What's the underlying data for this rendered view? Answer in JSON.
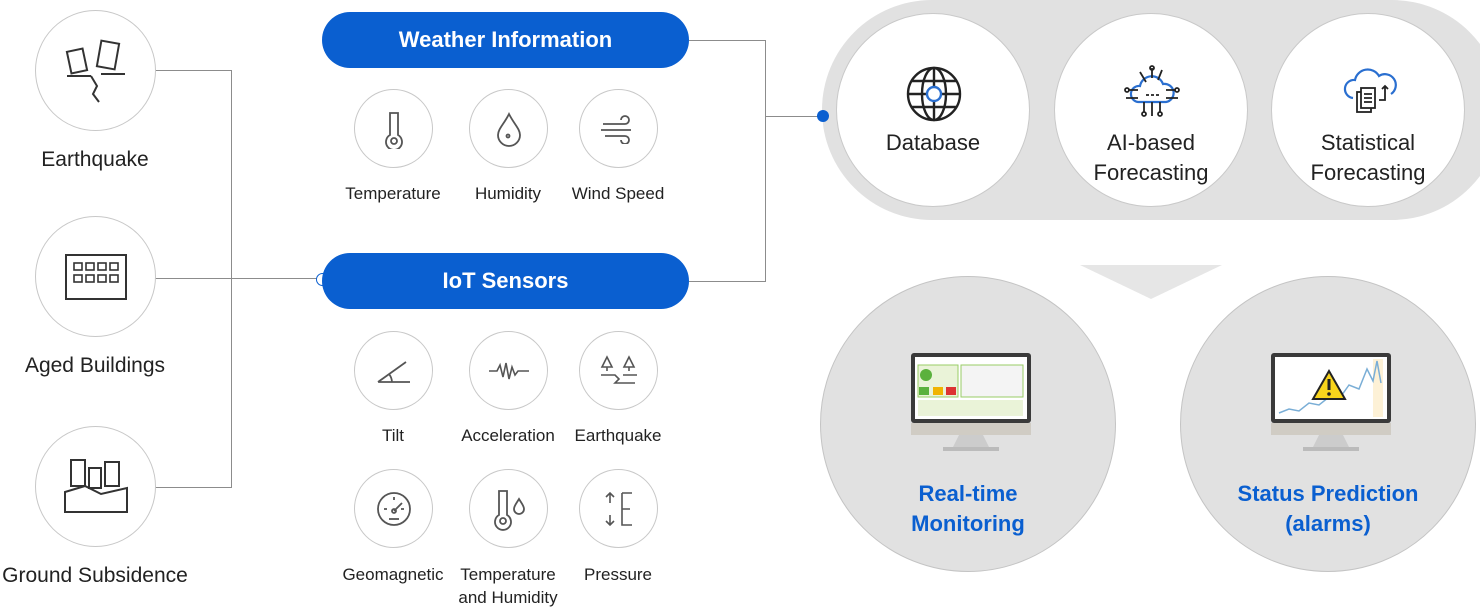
{
  "colors": {
    "accent": "#0a5fd0",
    "panel": "#e1e1e1",
    "line": "#8c8c8c"
  },
  "hazards": [
    {
      "label": "Earthquake",
      "icon": "collapsing-buildings-icon"
    },
    {
      "label": "Aged Buildings",
      "icon": "cracked-building-icon"
    },
    {
      "label": "Ground Subsidence",
      "icon": "sinking-buildings-icon"
    }
  ],
  "weather": {
    "title": "Weather Information",
    "items": [
      {
        "label": "Temperature",
        "icon": "thermometer-icon"
      },
      {
        "label": "Humidity",
        "icon": "water-drop-icon"
      },
      {
        "label": "Wind Speed",
        "icon": "wind-icon"
      }
    ]
  },
  "iot": {
    "title": "IoT Sensors",
    "items": [
      {
        "label": "Tilt",
        "icon": "angle-icon"
      },
      {
        "label": "Acceleration",
        "icon": "waveform-icon"
      },
      {
        "label": "Earthquake",
        "icon": "ground-crack-icon"
      },
      {
        "label": "Geomagnetic",
        "icon": "gauge-icon"
      },
      {
        "label": "Temperature and Humidity",
        "line1": "Temperature",
        "line2": "and Humidity",
        "icon": "thermometer-drop-icon"
      },
      {
        "label": "Pressure",
        "icon": "pressure-icon"
      }
    ]
  },
  "processing": [
    {
      "line1": "Database",
      "line2": "",
      "icon": "globe-icon"
    },
    {
      "line1": "AI-based",
      "line2": "Forecasting",
      "icon": "ai-cloud-icon"
    },
    {
      "line1": "Statistical",
      "line2": "Forecasting",
      "icon": "cloud-documents-icon"
    }
  ],
  "outputs": [
    {
      "line1": "Real-time",
      "line2": "Monitoring",
      "icon": "monitor-dashboard-icon"
    },
    {
      "line1": "Status Prediction",
      "line2": "(alarms)",
      "icon": "monitor-warning-icon"
    }
  ]
}
